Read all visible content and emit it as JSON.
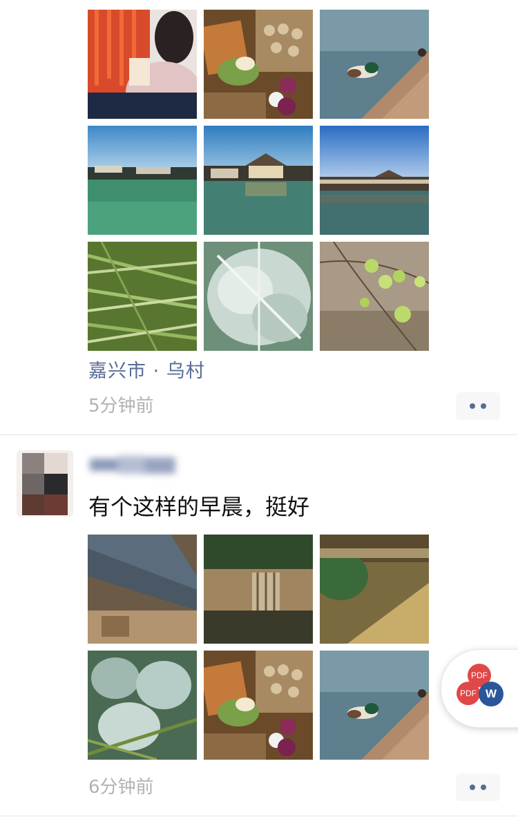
{
  "post1": {
    "location": "嘉兴市 · 乌村",
    "time": "5分钟前"
  },
  "post2": {
    "text": "有个这样的早晨，挺好",
    "time": "6分钟前"
  },
  "float_badge": {
    "pdf_top": "PDF",
    "pdf_left": "PDF",
    "word": "W"
  },
  "colors": {
    "link": "#576b95",
    "time": "#b2b2b2",
    "more_bg": "#f7f7f7",
    "pdf_red": "#e04848",
    "word_blue": "#2b579a"
  }
}
